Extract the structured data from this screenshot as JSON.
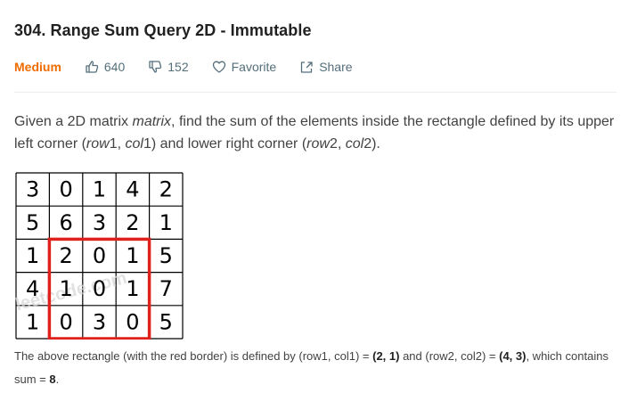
{
  "problem": {
    "title": "304. Range Sum Query 2D - Immutable",
    "difficulty": "Medium",
    "likes": "640",
    "dislikes": "152",
    "favorite_label": "Favorite",
    "share_label": "Share"
  },
  "description": {
    "p1": "Given a 2D matrix ",
    "matrix_word": "matrix",
    "p2": ", find the sum of the elements inside the rectangle defined by its upper left corner (",
    "row1": "row",
    "row1_sub": "1",
    "sep1": ", ",
    "col1": "col",
    "col1_sub": "1",
    "p3": ") and lower right corner (",
    "row2": "row",
    "row2_sub": "2",
    "sep2": ", ",
    "col2": "col",
    "col2_sub": "2",
    "p4": ")."
  },
  "matrix": {
    "rows": [
      [
        "3",
        "0",
        "1",
        "4",
        "2"
      ],
      [
        "5",
        "6",
        "3",
        "2",
        "1"
      ],
      [
        "1",
        "2",
        "0",
        "1",
        "5"
      ],
      [
        "4",
        "1",
        "0",
        "1",
        "7"
      ],
      [
        "1",
        "0",
        "3",
        "0",
        "5"
      ]
    ],
    "highlight": {
      "row1": 2,
      "col1": 1,
      "row2": 4,
      "col2": 3
    },
    "highlight_color": "#e0201b",
    "watermark": "leetcode.com"
  },
  "explanation": {
    "t1": "The above rectangle (with the red border) is defined by (row1, col1) = ",
    "b1": "(2, 1)",
    "t2": " and (row2, col2) = ",
    "b2": "(4, 3)",
    "t3": ", which contains sum = ",
    "b3": "8",
    "t4": "."
  },
  "colors": {
    "difficulty": "#ef6c00",
    "meta": "#546e7a"
  }
}
